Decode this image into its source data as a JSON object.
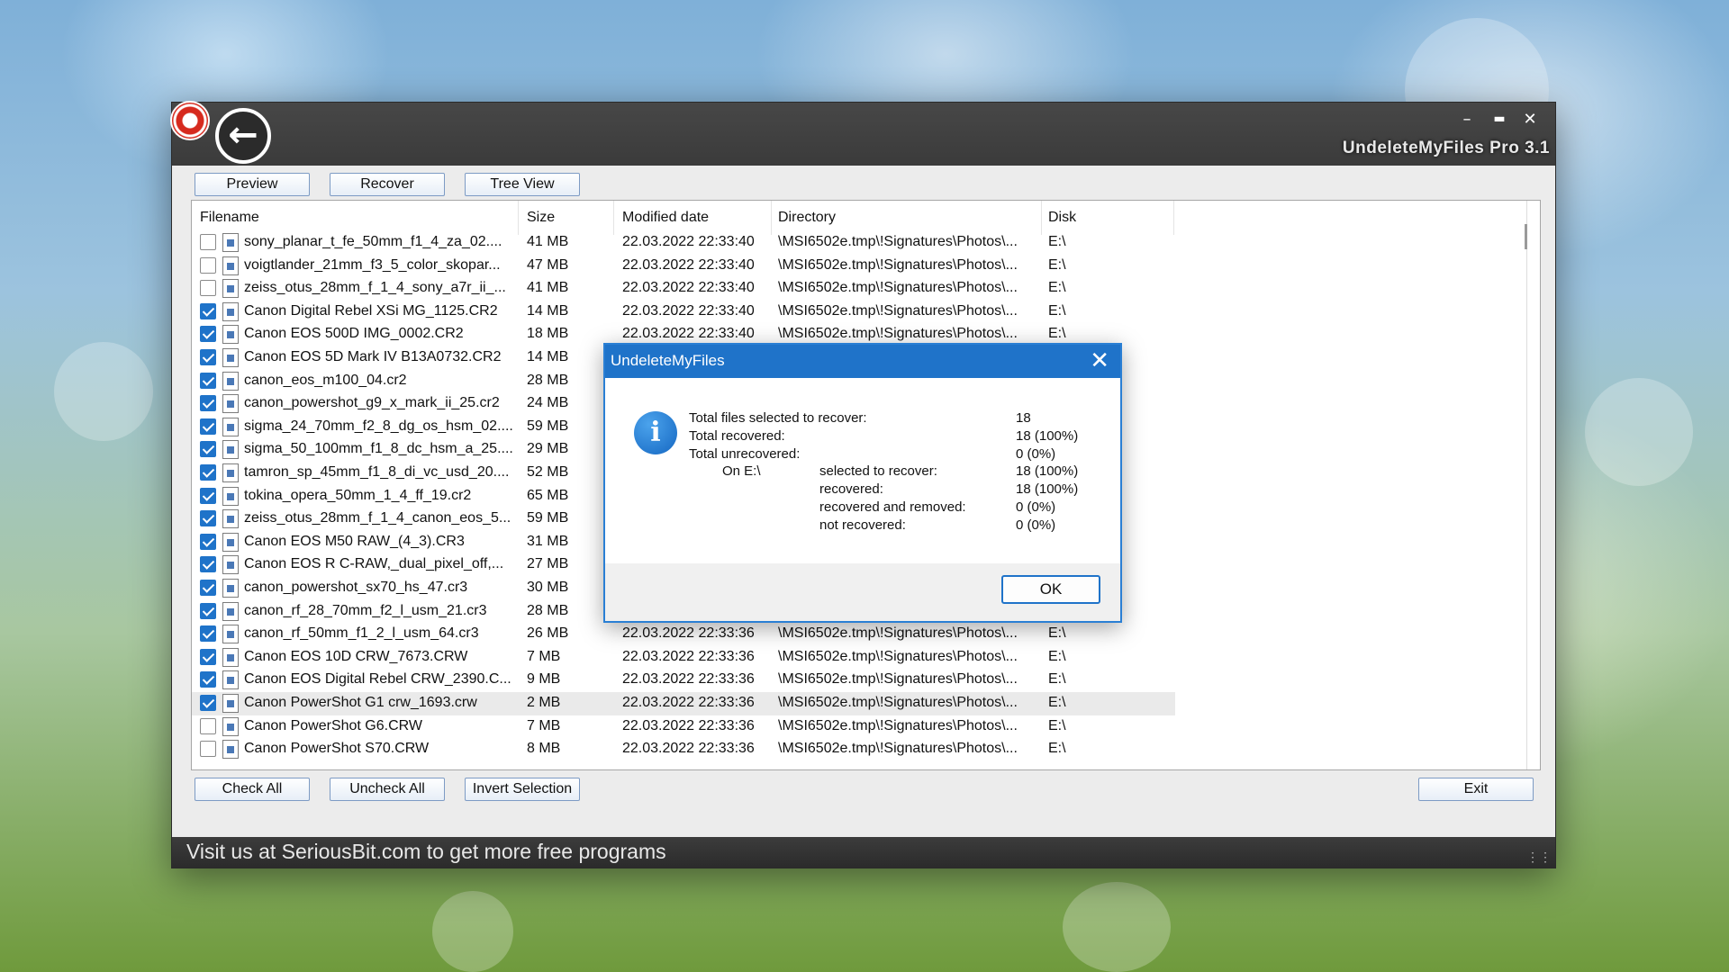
{
  "window": {
    "title": "UndeleteMyFiles Pro 3.1",
    "minimize_glyph": "–",
    "maximize_glyph": "▬",
    "close_glyph": "✕"
  },
  "toolbar": {
    "preview_label": "Preview",
    "recover_label": "Recover",
    "treeview_label": "Tree View"
  },
  "columns": {
    "filename": "Filename",
    "size": "Size",
    "modified": "Modified date",
    "directory": "Directory",
    "disk": "Disk"
  },
  "rows": [
    {
      "checked": false,
      "name": "sony_planar_t_fe_50mm_f1_4_za_02....",
      "size": "41 MB",
      "date": "22.03.2022 22:33:40",
      "dir": "\\MSI6502e.tmp\\!Signatures\\Photos\\...",
      "disk": "E:\\",
      "icon": "image-file-icon"
    },
    {
      "checked": false,
      "name": "voigtlander_21mm_f3_5_color_skopar...",
      "size": "47 MB",
      "date": "22.03.2022 22:33:40",
      "dir": "\\MSI6502e.tmp\\!Signatures\\Photos\\...",
      "disk": "E:\\",
      "icon": "image-file-icon"
    },
    {
      "checked": false,
      "name": "zeiss_otus_28mm_f_1_4_sony_a7r_ii_...",
      "size": "41 MB",
      "date": "22.03.2022 22:33:40",
      "dir": "\\MSI6502e.tmp\\!Signatures\\Photos\\...",
      "disk": "E:\\",
      "icon": "image-file-icon"
    },
    {
      "checked": true,
      "name": "Canon Digital Rebel XSi MG_1125.CR2",
      "size": "14 MB",
      "date": "22.03.2022 22:33:40",
      "dir": "\\MSI6502e.tmp\\!Signatures\\Photos\\...",
      "disk": "E:\\",
      "icon": "raw-file-icon"
    },
    {
      "checked": true,
      "name": "Canon EOS 500D IMG_0002.CR2",
      "size": "18 MB",
      "date": "22.03.2022 22:33:40",
      "dir": "\\MSI6502e.tmp\\!Signatures\\Photos\\...",
      "disk": "E:\\",
      "icon": "raw-file-icon"
    },
    {
      "checked": true,
      "name": "Canon EOS 5D Mark IV B13A0732.CR2",
      "size": "14 MB",
      "date": "",
      "dir": "",
      "disk": "",
      "icon": "raw-file-icon"
    },
    {
      "checked": true,
      "name": "canon_eos_m100_04.cr2",
      "size": "28 MB",
      "date": "",
      "dir": "",
      "disk": "",
      "icon": "raw-file-icon"
    },
    {
      "checked": true,
      "name": "canon_powershot_g9_x_mark_ii_25.cr2",
      "size": "24 MB",
      "date": "",
      "dir": "",
      "disk": "",
      "icon": "raw-file-icon"
    },
    {
      "checked": true,
      "name": "sigma_24_70mm_f2_8_dg_os_hsm_02....",
      "size": "59 MB",
      "date": "",
      "dir": "",
      "disk": "",
      "icon": "raw-file-icon"
    },
    {
      "checked": true,
      "name": "sigma_50_100mm_f1_8_dc_hsm_a_25....",
      "size": "29 MB",
      "date": "",
      "dir": "",
      "disk": "",
      "icon": "raw-file-icon"
    },
    {
      "checked": true,
      "name": "tamron_sp_45mm_f1_8_di_vc_usd_20....",
      "size": "52 MB",
      "date": "",
      "dir": "",
      "disk": "",
      "icon": "raw-file-icon"
    },
    {
      "checked": true,
      "name": "tokina_opera_50mm_1_4_ff_19.cr2",
      "size": "65 MB",
      "date": "",
      "dir": "",
      "disk": "",
      "icon": "raw-file-icon"
    },
    {
      "checked": true,
      "name": "zeiss_otus_28mm_f_1_4_canon_eos_5...",
      "size": "59 MB",
      "date": "",
      "dir": "",
      "disk": "",
      "icon": "raw-file-icon"
    },
    {
      "checked": true,
      "name": "Canon EOS M50 RAW_(4_3).CR3",
      "size": "31 MB",
      "date": "",
      "dir": "",
      "disk": "",
      "icon": "raw-file-icon"
    },
    {
      "checked": true,
      "name": "Canon EOS R C-RAW,_dual_pixel_off,...",
      "size": "27 MB",
      "date": "",
      "dir": "",
      "disk": "",
      "icon": "raw-file-icon"
    },
    {
      "checked": true,
      "name": "canon_powershot_sx70_hs_47.cr3",
      "size": "30 MB",
      "date": "",
      "dir": "",
      "disk": "",
      "icon": "raw-file-icon"
    },
    {
      "checked": true,
      "name": "canon_rf_28_70mm_f2_l_usm_21.cr3",
      "size": "28 MB",
      "date": "",
      "dir": "",
      "disk": "",
      "icon": "raw-file-icon"
    },
    {
      "checked": true,
      "name": "canon_rf_50mm_f1_2_l_usm_64.cr3",
      "size": "26 MB",
      "date": "22.03.2022 22:33:36",
      "dir": "\\MSI6502e.tmp\\!Signatures\\Photos\\...",
      "disk": "E:\\",
      "icon": "raw-file-icon"
    },
    {
      "checked": true,
      "name": "Canon EOS 10D CRW_7673.CRW",
      "size": "7 MB",
      "date": "22.03.2022 22:33:36",
      "dir": "\\MSI6502e.tmp\\!Signatures\\Photos\\...",
      "disk": "E:\\",
      "icon": "image-file-icon"
    },
    {
      "checked": true,
      "name": "Canon EOS Digital Rebel CRW_2390.C...",
      "size": "9 MB",
      "date": "22.03.2022 22:33:36",
      "dir": "\\MSI6502e.tmp\\!Signatures\\Photos\\...",
      "disk": "E:\\",
      "icon": "image-file-icon"
    },
    {
      "checked": true,
      "name": "Canon PowerShot G1 crw_1693.crw",
      "size": "2 MB",
      "date": "22.03.2022 22:33:36",
      "dir": "\\MSI6502e.tmp\\!Signatures\\Photos\\...",
      "disk": "E:\\",
      "icon": "image-file-icon",
      "selected": true
    },
    {
      "checked": false,
      "name": "Canon PowerShot G6.CRW",
      "size": "7 MB",
      "date": "22.03.2022 22:33:36",
      "dir": "\\MSI6502e.tmp\\!Signatures\\Photos\\...",
      "disk": "E:\\",
      "icon": "image-file-icon"
    },
    {
      "checked": false,
      "name": "Canon PowerShot S70.CRW",
      "size": "8 MB",
      "date": "22.03.2022 22:33:36",
      "dir": "\\MSI6502e.tmp\\!Signatures\\Photos\\...",
      "disk": "E:\\",
      "icon": "image-file-icon"
    }
  ],
  "bottom": {
    "check_all": "Check All",
    "uncheck_all": "Uncheck All",
    "invert_selection": "Invert Selection",
    "exit": "Exit"
  },
  "status": {
    "text": "Visit us at SeriousBit.com to get more free programs"
  },
  "dialog": {
    "title": "UndeleteMyFiles",
    "close_glyph": "✕",
    "icon": "info-icon",
    "lines": [
      {
        "label": "Total files selected to recover:",
        "value": "18"
      },
      {
        "label": "Total recovered:",
        "value": "18 (100%)"
      },
      {
        "label": "Total unrecovered:",
        "value": "0 (0%)"
      }
    ],
    "drive_label": "On E:\\",
    "drive_lines": [
      {
        "label": "selected to recover:",
        "value": "18 (100%)"
      },
      {
        "label": "recovered:",
        "value": "18 (100%)"
      },
      {
        "label": "recovered and removed:",
        "value": "0 (0%)"
      },
      {
        "label": "not recovered:",
        "value": "0 (0%)"
      }
    ],
    "ok_label": "OK"
  },
  "colors": {
    "accent": "#1f73c9",
    "titlebar": "#3b3b3b",
    "checked": "#1f73c9"
  }
}
